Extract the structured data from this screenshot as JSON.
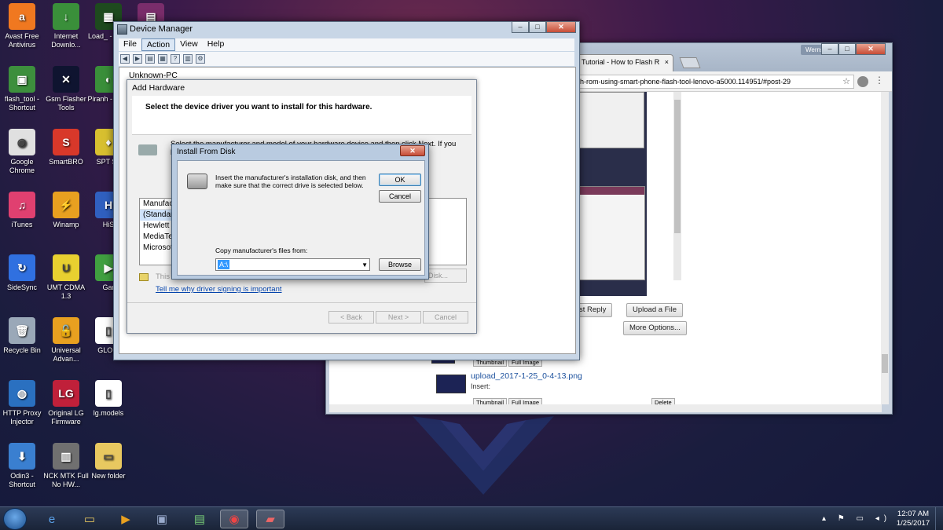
{
  "desktop": {
    "icons": [
      {
        "label": "Avast Free Antivirus",
        "icon": "avast-icon",
        "color": "#f07820",
        "glyph": "a"
      },
      {
        "label": "Internet Downlo...",
        "icon": "download-manager-icon",
        "color": "#3a8f3a",
        "glyph": "↓"
      },
      {
        "label": "Load_ - Shor",
        "icon": "matrix-icon",
        "color": "#1e4a1e",
        "glyph": "▦"
      },
      {
        "label": "",
        "icon": "winrar-icon",
        "color": "#7a2d6b",
        "glyph": "▤"
      },
      {
        "label": "flash_tool - Shortcut",
        "icon": "flash-tool-icon",
        "color": "#3d8f3d",
        "glyph": "▣"
      },
      {
        "label": "Gsm Flasher Tools",
        "icon": "gsm-flasher-icon",
        "color": "#0f1430",
        "glyph": "✕"
      },
      {
        "label": "Piranh - Shor",
        "icon": "piranha-icon",
        "color": "#3a8f3a",
        "glyph": "◐"
      },
      {
        "label": "Google Chrome",
        "icon": "chrome-icon",
        "color": "#e0e0e0",
        "glyph": "◉"
      },
      {
        "label": "SmartBRO",
        "icon": "smartbro-icon",
        "color": "#d8382a",
        "glyph": "S"
      },
      {
        "label": "SPT Sh",
        "icon": "spt-icon",
        "color": "#d8c030",
        "glyph": "♦"
      },
      {
        "label": "iTunes",
        "icon": "itunes-icon",
        "color": "#e04070",
        "glyph": "♫"
      },
      {
        "label": "Winamp",
        "icon": "winamp-icon",
        "color": "#e8a020",
        "glyph": "⚡"
      },
      {
        "label": "HiS",
        "icon": "hisuite-icon",
        "color": "#3060c0",
        "glyph": "H"
      },
      {
        "label": "SideSync",
        "icon": "sidesync-icon",
        "color": "#3070e0",
        "glyph": "↻"
      },
      {
        "label": "UMT CDMA 1.3",
        "icon": "umt-icon",
        "color": "#e8d030",
        "glyph": "U"
      },
      {
        "label": "Gar",
        "icon": "game-icon",
        "color": "#40a040",
        "glyph": "▶"
      },
      {
        "label": "Recycle Bin",
        "icon": "recycle-bin-icon",
        "color": "#9aa8b8",
        "glyph": "🗑"
      },
      {
        "label": "Universal Advan...",
        "icon": "lock-icon",
        "color": "#e8a020",
        "glyph": "🔓"
      },
      {
        "label": "GLOBI",
        "icon": "globe-icon",
        "color": "#ffffff",
        "glyph": "▯"
      },
      {
        "label": "HTTP Proxy Injector",
        "icon": "proxy-icon",
        "color": "#2a70c0",
        "glyph": "◍"
      },
      {
        "label": "Original LG Firmware",
        "icon": "lg-icon",
        "color": "#c0203a",
        "glyph": "LG"
      },
      {
        "label": "lg.models",
        "icon": "file-icon",
        "color": "#ffffff",
        "glyph": "▯"
      },
      {
        "label": "Odin3 - Shortcut",
        "icon": "odin-icon",
        "color": "#3a7fd0",
        "glyph": "⬇"
      },
      {
        "label": "NCK MTK Full No HW...",
        "icon": "nck-icon",
        "color": "#707070",
        "glyph": "▥"
      },
      {
        "label": "New folder",
        "icon": "folder-icon",
        "color": "#e8c860",
        "glyph": "▭"
      }
    ]
  },
  "chrome": {
    "tab_title": "Tutorial - How to Flash R",
    "tab_close": "×",
    "user_badge": "Werns",
    "url": "h-rom-using-smart-phone-flash-tool-lenovo-a5000.114951/#post-29",
    "star": "☆",
    "menu": "⋮",
    "window_btns": {
      "min": "–",
      "max": "□",
      "close": "✕"
    },
    "post_reply": "st Reply",
    "upload_file": "Upload a File",
    "more_options": "More Options...",
    "thumbnail": "Thumbnail",
    "full_image": "Full Image",
    "delete": "Delete",
    "file_name": "upload_2017-1-25_0-4-13.png",
    "insert": "Insert:"
  },
  "devmgr": {
    "title": "Device Manager",
    "menu": [
      "File",
      "Action",
      "View",
      "Help"
    ],
    "active_menu": "Action",
    "tree_root": "Unknown-PC",
    "window_btns": {
      "min": "–",
      "max": "□",
      "close": "✕"
    }
  },
  "addhw": {
    "title": "Add Hardware",
    "heading": "Select the device driver you want to install for this hardware.",
    "desc": "Select the manufacturer and model of your hardware device and then click Next. If you have a",
    "manufacturers_header": "Manufactu",
    "manufacturers": [
      "(Standard",
      "Hewlett P",
      "MediaTek",
      "Microsoft"
    ],
    "signed_text": "This d",
    "sign_link": "Tell me why driver signing is important",
    "have_disk": "Disk...",
    "back": "< Back",
    "next": "Next >",
    "cancel": "Cancel"
  },
  "ifd": {
    "title": "Install From Disk",
    "close": "✕",
    "message": "Insert the manufacturer's installation disk, and then make sure that the correct drive is selected below.",
    "ok": "OK",
    "cancel": "Cancel",
    "copy_label": "Copy manufacturer's files from:",
    "path": "A:\\",
    "browse": "Browse"
  },
  "taskbar": {
    "time": "12:07 AM",
    "date": "1/25/2017",
    "tray": "▴ ⚑ ▭ ◂)"
  }
}
